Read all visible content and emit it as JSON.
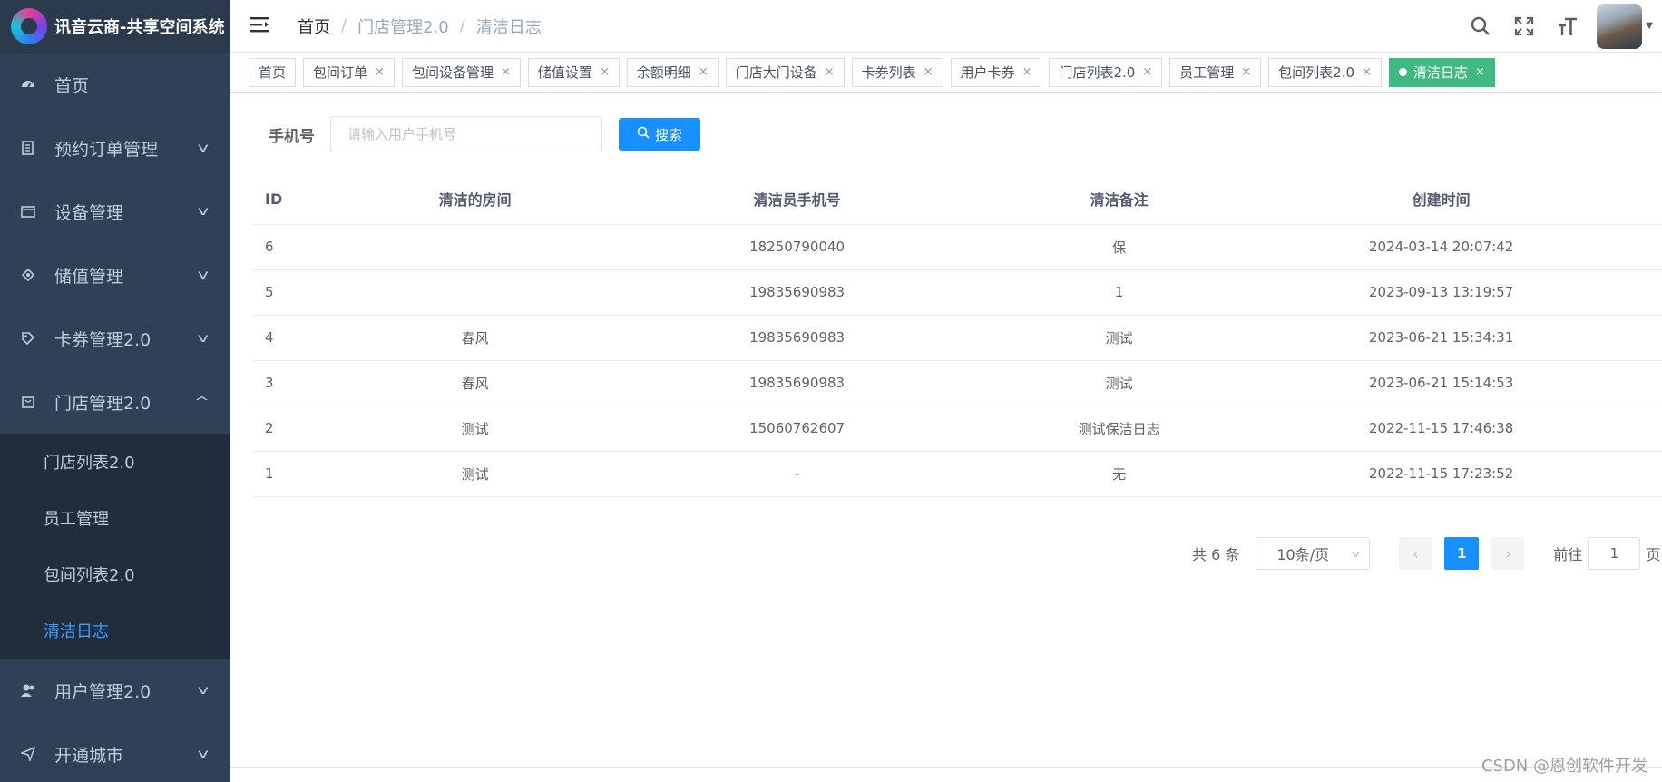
{
  "app": {
    "title": "讯音云商-共享空间系统"
  },
  "sidebar": {
    "items": [
      {
        "label": "首页",
        "icon": "dashboard-icon"
      },
      {
        "label": "预约订单管理",
        "icon": "order-icon"
      },
      {
        "label": "设备管理",
        "icon": "device-icon"
      },
      {
        "label": "储值管理",
        "icon": "stored-value-icon"
      },
      {
        "label": "卡券管理2.0",
        "icon": "coupon-icon"
      },
      {
        "label": "门店管理2.0",
        "icon": "store-icon"
      },
      {
        "label": "用户管理2.0",
        "icon": "user-icon"
      },
      {
        "label": "开通城市",
        "icon": "send-icon"
      }
    ],
    "submenu": [
      "门店列表2.0",
      "员工管理",
      "包间列表2.0",
      "清洁日志"
    ]
  },
  "breadcrumb": {
    "home": "首页",
    "level2": "门店管理2.0",
    "current": "清洁日志"
  },
  "tags": [
    "首页",
    "包间订单",
    "包间设备管理",
    "储值设置",
    "余额明细",
    "门店大门设备",
    "卡券列表",
    "用户卡券",
    "门店列表2.0",
    "员工管理",
    "包间列表2.0",
    "清洁日志"
  ],
  "search": {
    "label": "手机号",
    "placeholder": "请输入用户手机号",
    "button": "搜索"
  },
  "table": {
    "headers": [
      "ID",
      "清洁的房间",
      "清洁员手机号",
      "清洁备注",
      "创建时间"
    ],
    "rows": [
      [
        "6",
        "",
        "18250790040",
        "保",
        "2024-03-14 20:07:42"
      ],
      [
        "5",
        "",
        "19835690983",
        "1",
        "2023-09-13 13:19:57"
      ],
      [
        "4",
        "春风",
        "19835690983",
        "测试",
        "2023-06-21 15:34:31"
      ],
      [
        "3",
        "春风",
        "19835690983",
        "测试",
        "2023-06-21 15:14:53"
      ],
      [
        "2",
        "测试",
        "15060762607",
        "测试保洁日志",
        "2022-11-15 17:46:38"
      ],
      [
        "1",
        "测试",
        "-",
        "无",
        "2022-11-15 17:23:52"
      ]
    ]
  },
  "pagination": {
    "total": "共 6 条",
    "page_size": "10条/页",
    "current": "1",
    "goto_label": "前往",
    "goto_value": "1",
    "page_unit": "页"
  },
  "watermark": "CSDN @恩创软件开发",
  "colors": {
    "sidebar_bg": "#304156",
    "submenu_bg": "#1f2d3d",
    "accent": "#1890ff",
    "active_tag": "#42b983",
    "active_submenu": "#409eff"
  }
}
